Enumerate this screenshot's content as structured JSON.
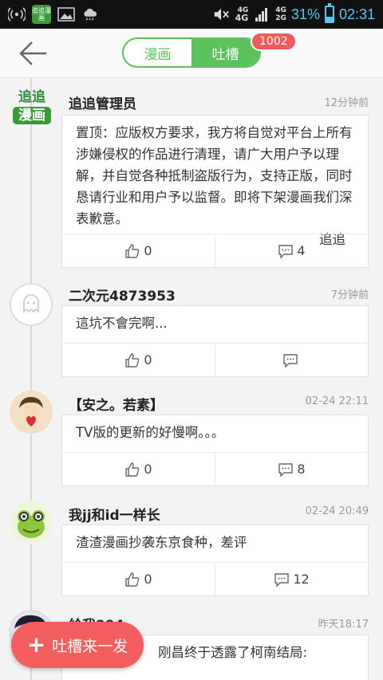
{
  "status_bar": {
    "app_icon_text": "追追漫画",
    "net_top": "4G",
    "net_type": "4G",
    "net_bottom": "2G",
    "battery_percent": "31%",
    "battery_level": 0.31,
    "time": "02:31"
  },
  "header": {
    "tabs": [
      {
        "label": "漫画"
      },
      {
        "label": "吐槽"
      }
    ],
    "badge": "1002"
  },
  "posts": [
    {
      "username": "追追管理员",
      "avatar_text_top": "追追",
      "avatar_text_bottom": "漫画",
      "time": "12分钟前",
      "text": "置顶：应版权方要求，我方将自觉对平台上所有涉嫌侵权的作品进行清理，请广大用户予以理解，并自觉各种抵制盗版行为，支持正版，同时恳请行业和用户予以监督。即将下架漫画我们深表歉意。",
      "signature": "追追",
      "likes": "0",
      "comments": "4"
    },
    {
      "username": "二次元4873953",
      "time": "7分钟前",
      "text": "這坑不會完啊...",
      "likes": "0",
      "comments": ""
    },
    {
      "username": "【安之。若素】",
      "time": "02-24 22:11",
      "text": "TV版的更新的好慢啊。。。",
      "likes": "0",
      "comments": "8"
    },
    {
      "username": "我jj和id一样长",
      "time": "02-24 20:49",
      "text": "渣渣漫画抄袭东京食种，差评",
      "likes": "0",
      "comments": "12"
    },
    {
      "username": "給我994",
      "time": "昨天18:17",
      "text": "刚昌终于透露了柯南结局:"
    }
  ],
  "fab": {
    "label": "吐槽来一发"
  },
  "colors": {
    "accent_green": "#5cc15c",
    "badge_red": "#f15b5b",
    "fab_red": "#f45e5e",
    "status_blue": "#56c7f0"
  }
}
